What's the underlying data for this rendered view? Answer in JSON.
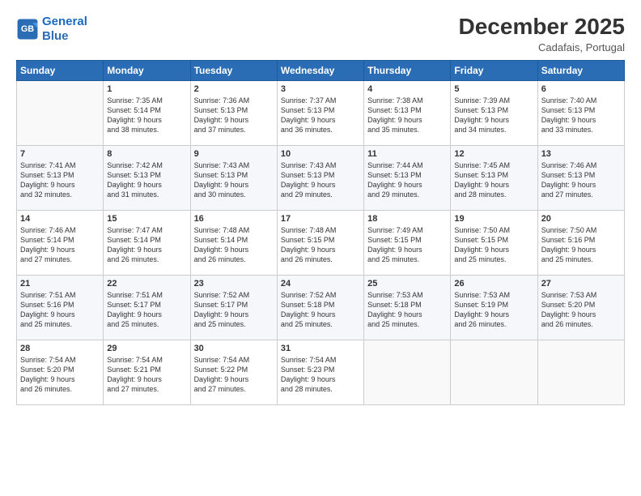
{
  "logo": {
    "line1": "General",
    "line2": "Blue"
  },
  "title": "December 2025",
  "subtitle": "Cadafais, Portugal",
  "days_header": [
    "Sunday",
    "Monday",
    "Tuesday",
    "Wednesday",
    "Thursday",
    "Friday",
    "Saturday"
  ],
  "weeks": [
    [
      {
        "day": "",
        "info": ""
      },
      {
        "day": "1",
        "info": "Sunrise: 7:35 AM\nSunset: 5:14 PM\nDaylight: 9 hours\nand 38 minutes."
      },
      {
        "day": "2",
        "info": "Sunrise: 7:36 AM\nSunset: 5:13 PM\nDaylight: 9 hours\nand 37 minutes."
      },
      {
        "day": "3",
        "info": "Sunrise: 7:37 AM\nSunset: 5:13 PM\nDaylight: 9 hours\nand 36 minutes."
      },
      {
        "day": "4",
        "info": "Sunrise: 7:38 AM\nSunset: 5:13 PM\nDaylight: 9 hours\nand 35 minutes."
      },
      {
        "day": "5",
        "info": "Sunrise: 7:39 AM\nSunset: 5:13 PM\nDaylight: 9 hours\nand 34 minutes."
      },
      {
        "day": "6",
        "info": "Sunrise: 7:40 AM\nSunset: 5:13 PM\nDaylight: 9 hours\nand 33 minutes."
      }
    ],
    [
      {
        "day": "7",
        "info": "Sunrise: 7:41 AM\nSunset: 5:13 PM\nDaylight: 9 hours\nand 32 minutes."
      },
      {
        "day": "8",
        "info": "Sunrise: 7:42 AM\nSunset: 5:13 PM\nDaylight: 9 hours\nand 31 minutes."
      },
      {
        "day": "9",
        "info": "Sunrise: 7:43 AM\nSunset: 5:13 PM\nDaylight: 9 hours\nand 30 minutes."
      },
      {
        "day": "10",
        "info": "Sunrise: 7:43 AM\nSunset: 5:13 PM\nDaylight: 9 hours\nand 29 minutes."
      },
      {
        "day": "11",
        "info": "Sunrise: 7:44 AM\nSunset: 5:13 PM\nDaylight: 9 hours\nand 29 minutes."
      },
      {
        "day": "12",
        "info": "Sunrise: 7:45 AM\nSunset: 5:13 PM\nDaylight: 9 hours\nand 28 minutes."
      },
      {
        "day": "13",
        "info": "Sunrise: 7:46 AM\nSunset: 5:13 PM\nDaylight: 9 hours\nand 27 minutes."
      }
    ],
    [
      {
        "day": "14",
        "info": "Sunrise: 7:46 AM\nSunset: 5:14 PM\nDaylight: 9 hours\nand 27 minutes."
      },
      {
        "day": "15",
        "info": "Sunrise: 7:47 AM\nSunset: 5:14 PM\nDaylight: 9 hours\nand 26 minutes."
      },
      {
        "day": "16",
        "info": "Sunrise: 7:48 AM\nSunset: 5:14 PM\nDaylight: 9 hours\nand 26 minutes."
      },
      {
        "day": "17",
        "info": "Sunrise: 7:48 AM\nSunset: 5:15 PM\nDaylight: 9 hours\nand 26 minutes."
      },
      {
        "day": "18",
        "info": "Sunrise: 7:49 AM\nSunset: 5:15 PM\nDaylight: 9 hours\nand 25 minutes."
      },
      {
        "day": "19",
        "info": "Sunrise: 7:50 AM\nSunset: 5:15 PM\nDaylight: 9 hours\nand 25 minutes."
      },
      {
        "day": "20",
        "info": "Sunrise: 7:50 AM\nSunset: 5:16 PM\nDaylight: 9 hours\nand 25 minutes."
      }
    ],
    [
      {
        "day": "21",
        "info": "Sunrise: 7:51 AM\nSunset: 5:16 PM\nDaylight: 9 hours\nand 25 minutes."
      },
      {
        "day": "22",
        "info": "Sunrise: 7:51 AM\nSunset: 5:17 PM\nDaylight: 9 hours\nand 25 minutes."
      },
      {
        "day": "23",
        "info": "Sunrise: 7:52 AM\nSunset: 5:17 PM\nDaylight: 9 hours\nand 25 minutes."
      },
      {
        "day": "24",
        "info": "Sunrise: 7:52 AM\nSunset: 5:18 PM\nDaylight: 9 hours\nand 25 minutes."
      },
      {
        "day": "25",
        "info": "Sunrise: 7:53 AM\nSunset: 5:18 PM\nDaylight: 9 hours\nand 25 minutes."
      },
      {
        "day": "26",
        "info": "Sunrise: 7:53 AM\nSunset: 5:19 PM\nDaylight: 9 hours\nand 26 minutes."
      },
      {
        "day": "27",
        "info": "Sunrise: 7:53 AM\nSunset: 5:20 PM\nDaylight: 9 hours\nand 26 minutes."
      }
    ],
    [
      {
        "day": "28",
        "info": "Sunrise: 7:54 AM\nSunset: 5:20 PM\nDaylight: 9 hours\nand 26 minutes."
      },
      {
        "day": "29",
        "info": "Sunrise: 7:54 AM\nSunset: 5:21 PM\nDaylight: 9 hours\nand 27 minutes."
      },
      {
        "day": "30",
        "info": "Sunrise: 7:54 AM\nSunset: 5:22 PM\nDaylight: 9 hours\nand 27 minutes."
      },
      {
        "day": "31",
        "info": "Sunrise: 7:54 AM\nSunset: 5:23 PM\nDaylight: 9 hours\nand 28 minutes."
      },
      {
        "day": "",
        "info": ""
      },
      {
        "day": "",
        "info": ""
      },
      {
        "day": "",
        "info": ""
      }
    ]
  ]
}
